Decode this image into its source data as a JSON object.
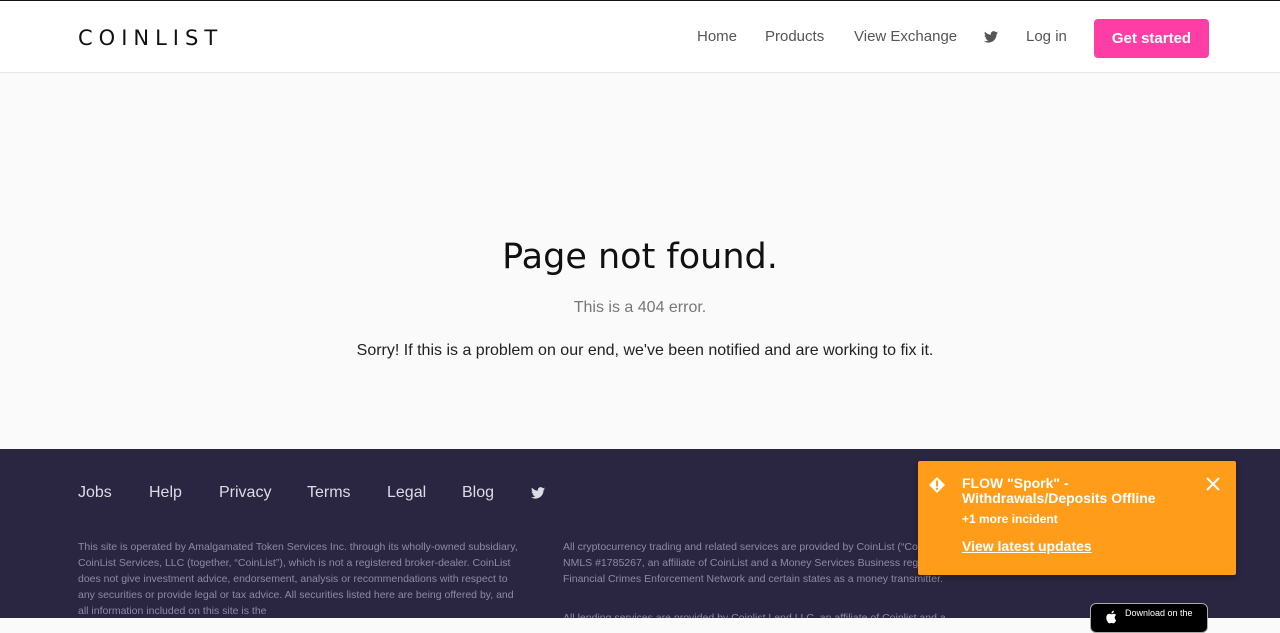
{
  "header": {
    "logo": "COINLIST",
    "nav": [
      "Home",
      "Products",
      "View Exchange"
    ],
    "login": "Log in",
    "cta": "Get started"
  },
  "main": {
    "title": "Page not found.",
    "subtitle": "This is a 404 error.",
    "message": "Sorry! If this is a problem on our end, we've been notified and are working to fix it."
  },
  "footer": {
    "links": [
      "Jobs",
      "Help",
      "Privacy",
      "Terms",
      "Legal",
      "Blog"
    ],
    "legal_left": "This site is operated by Amalgamated Token Services Inc. through its wholly-owned subsidiary, CoinList Services, LLC (together, “CoinList”), which is not a registered broker-dealer. CoinList does not give investment advice, endorsement, analysis or recommendations with respect to any securities or provide legal or tax advice. All securities listed here are being offered by, and all information included on this site is the",
    "legal_right": "All cryptocurrency trading and related services are provided by CoinList (“CoinList Markets”) NMLS #1785267, an affiliate of CoinList and a Money Services Business registered with Financial Crimes Enforcement Network and certain states as a money transmitter.",
    "legal_right_2": "All lending services are provided by Coinlist Lend LLC, an affiliate of Coinlist and a",
    "appstore": "Download on the"
  },
  "toast": {
    "title": "FLOW \"Spork\" - Withdrawals/Deposits Offline",
    "more": "+1 more incident",
    "link": "View latest updates"
  },
  "colors": {
    "accent": "#ff3ea5",
    "footer_bg": "#2a2540",
    "toast_bg": "#ff9c1a"
  }
}
